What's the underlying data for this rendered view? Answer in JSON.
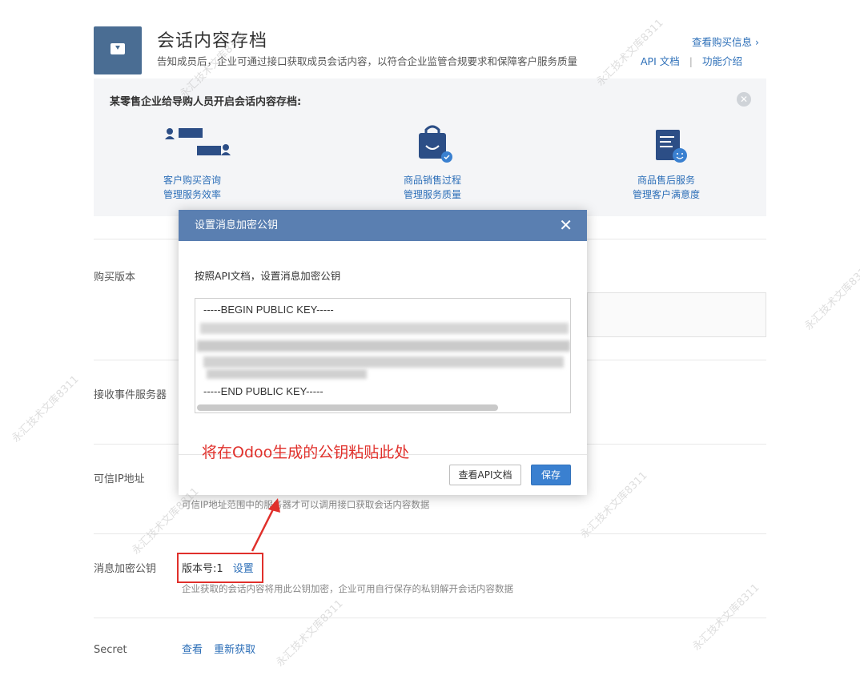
{
  "header": {
    "title": "会话内容存档",
    "description": "告知成员后，企业可通过接口获取成员会话内容，以符合企业监管合规要求和保障客户服务质量",
    "api_doc_link": "API 文档",
    "intro_link": "功能介绍",
    "view_purchase": "查看购买信息 ›"
  },
  "example": {
    "title": "某零售企业给导购人员开启会话内容存档:",
    "features": [
      {
        "line1": "客户购买咨询",
        "line2": "管理服务效率",
        "icon": "chat-users-icon"
      },
      {
        "line1": "商品销售过程",
        "line2": "管理服务质量",
        "icon": "shopping-bag-icon"
      },
      {
        "line1": "商品售后服务",
        "line2": "管理客户满意度",
        "icon": "document-smile-icon"
      }
    ]
  },
  "rows": {
    "purchase_version": "购买版本",
    "event_server": "接收事件服务器",
    "trusted_ip": "可信IP地址",
    "trusted_ip_hint": "可信IP地址范围中的服务器才可以调用接口获取会话内容数据",
    "encrypt_key": "消息加密公钥",
    "encrypt_version": "版本号:1",
    "encrypt_set": "设置",
    "encrypt_hint": "企业获取的会话内容将用此公钥加密，企业可用自行保存的私钥解开会话内容数据",
    "secret": "Secret",
    "secret_view": "查看",
    "secret_refresh": "重新获取"
  },
  "modal": {
    "title": "设置消息加密公钥",
    "close": "✕",
    "instruction": "按照API文档，设置消息加密公钥",
    "key_begin": "-----BEGIN PUBLIC KEY-----",
    "key_end": "-----END PUBLIC KEY-----",
    "btn_docs": "查看API文档",
    "btn_save": "保存"
  },
  "annotation": {
    "text": "将在Odoo生成的公钥粘贴此处",
    "color": "#e0302b"
  },
  "watermark": "永汇技术文库8311",
  "colors": {
    "accent": "#2d6fb8",
    "modal_header": "#5a7fb1",
    "primary_button": "#3a80d0"
  }
}
